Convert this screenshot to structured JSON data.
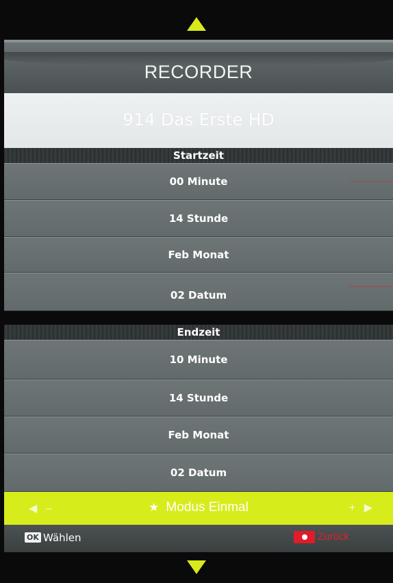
{
  "title": "RECORDER",
  "channel": "914 Das Erste HD",
  "start_section": {
    "header": "Startzeit",
    "rows": [
      {
        "label": "00 Minute"
      },
      {
        "label": "14 Stunde"
      },
      {
        "label": "Feb  Monat"
      },
      {
        "label": "02 Datum"
      }
    ]
  },
  "end_section": {
    "header": "Endzeit",
    "rows": [
      {
        "label": "10 Minute"
      },
      {
        "label": "14 Stunde"
      },
      {
        "label": "Feb  Monat"
      },
      {
        "label": "02 Datum"
      }
    ]
  },
  "mode_bar": {
    "left_hint": "◀ –",
    "label": "Modus Einmal",
    "right_hint": "+ ▶",
    "star_icon": "star-icon",
    "color": "#d7ec1b"
  },
  "footer": {
    "ok_key": "OK",
    "ok_label": "Wählen",
    "back_label": "Zurück",
    "back_key_color": "#e01c2a"
  },
  "nav": {
    "up_icon": "triangle-up-icon",
    "down_icon": "triangle-down-icon",
    "accent": "#d6ea1c"
  }
}
